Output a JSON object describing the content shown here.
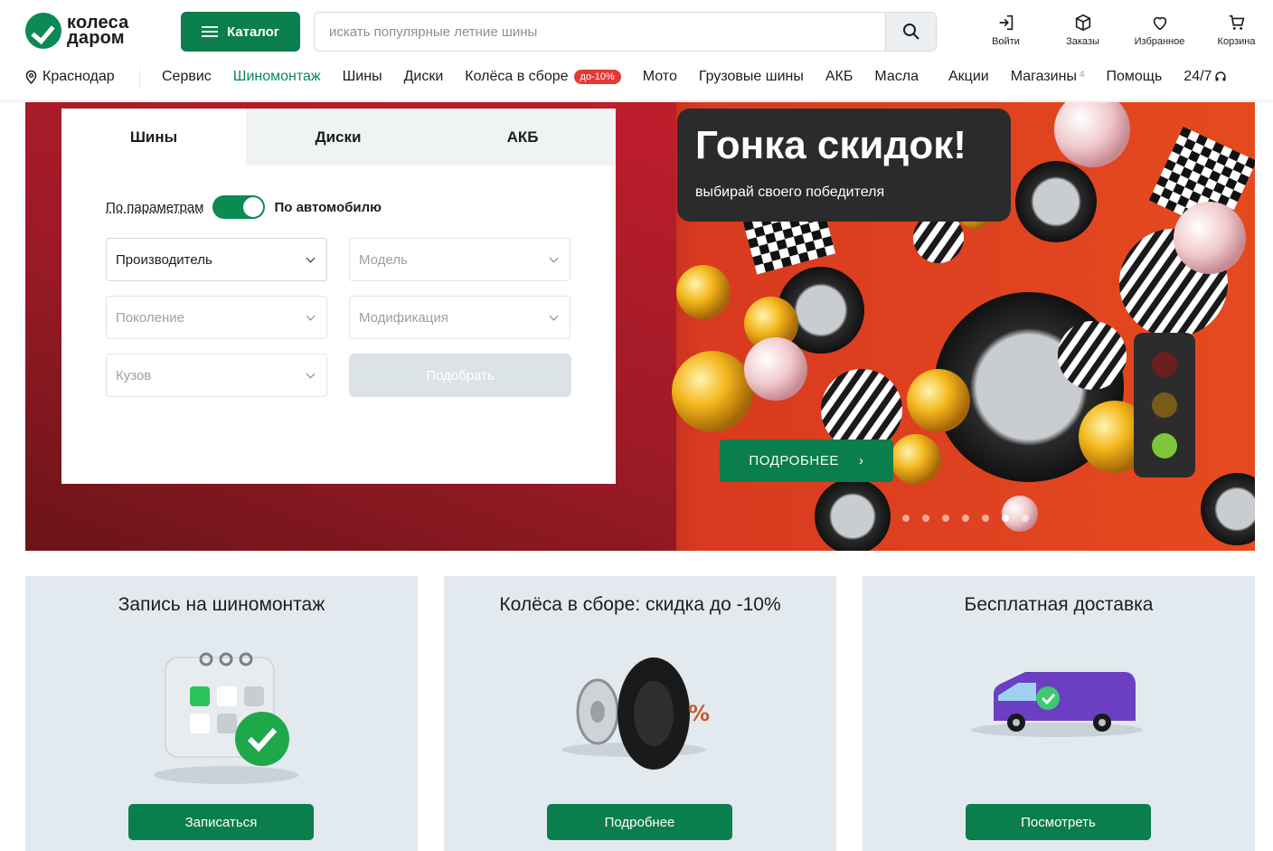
{
  "header": {
    "logo_line1": "колеса",
    "logo_line2": "даром",
    "catalog_label": "Каталог",
    "search_placeholder": "искать популярные летние шины",
    "actions": [
      {
        "label": "Войти",
        "icon": "login-icon"
      },
      {
        "label": "Заказы",
        "icon": "box-icon"
      },
      {
        "label": "Избранное",
        "icon": "heart-icon"
      },
      {
        "label": "Корзина",
        "icon": "cart-icon"
      }
    ]
  },
  "nav": {
    "city": "Краснодар",
    "items": [
      {
        "label": "Сервис"
      },
      {
        "label": "Шиномонтаж"
      },
      {
        "label": "Шины"
      },
      {
        "label": "Диски"
      },
      {
        "label": "Колёса в сборе"
      },
      {
        "label": "Мото"
      },
      {
        "label": "Грузовые шины"
      },
      {
        "label": "АКБ"
      },
      {
        "label": "Масла"
      },
      {
        "label": "Акции"
      },
      {
        "label": "Магазины"
      },
      {
        "label": "Помощь"
      },
      {
        "label": "24/7"
      }
    ],
    "badge": "до-10%",
    "stores_count": "4"
  },
  "finder": {
    "tabs": [
      "Шины",
      "Диски",
      "АКБ"
    ],
    "by_params": "По параметрам",
    "by_car": "По автомобилю",
    "fields": {
      "manufacturer": "Производитель",
      "model": "Модель",
      "generation": "Поколение",
      "modification": "Модификация",
      "body": "Кузов"
    },
    "submit": "Подобрать"
  },
  "hero": {
    "title": "Гонка скидок!",
    "subtitle": "выбирай своего победителя",
    "button": "ПОДРОБНЕЕ",
    "slides_total": 7,
    "active_slide": 6
  },
  "cards": [
    {
      "title": "Запись на шиномонтаж",
      "button": "Записаться"
    },
    {
      "title": "Колёса в сборе: скидка до -10%",
      "button": "Подробнее"
    },
    {
      "title": "Бесплатная доставка",
      "button": "Посмотреть"
    }
  ],
  "colors": {
    "brand_green": "#0b7e4d",
    "badge_red": "#e53935",
    "hero_red": "#e54a1f",
    "card_bg": "#e3eaef"
  }
}
